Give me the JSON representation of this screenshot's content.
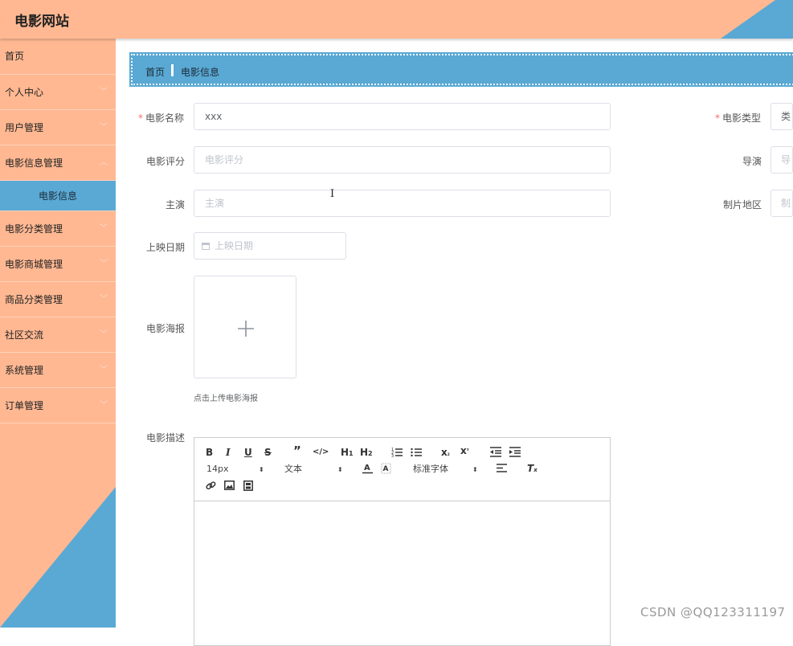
{
  "header": {
    "title": "电影网站"
  },
  "sidebar": {
    "items": [
      {
        "label": "首页",
        "chevron": false
      },
      {
        "label": "个人中心",
        "chevron": true
      },
      {
        "label": "用户管理",
        "chevron": true
      },
      {
        "label": "电影信息管理",
        "chevron": true
      },
      {
        "label": "电影分类管理",
        "chevron": true
      },
      {
        "label": "电影商城管理",
        "chevron": true
      },
      {
        "label": "商品分类管理",
        "chevron": true
      },
      {
        "label": "社区交流",
        "chevron": true
      },
      {
        "label": "系统管理",
        "chevron": true
      },
      {
        "label": "订单管理",
        "chevron": true
      }
    ],
    "sub_item": "电影信息"
  },
  "breadcrumb": {
    "home": "首页",
    "current": "电影信息"
  },
  "form": {
    "name_label": "电影名称",
    "name_value": "xxx",
    "type_label": "电影类型",
    "type_value": "类",
    "score_label": "电影评分",
    "score_placeholder": "电影评分",
    "director_label": "导演",
    "director_placeholder": "导",
    "actor_label": "主演",
    "actor_placeholder": "主演",
    "region_label": "制片地区",
    "region_placeholder": "制",
    "date_label": "上映日期",
    "date_placeholder": "上映日期",
    "poster_label": "电影海报",
    "poster_tip": "点击上传电影海报",
    "desc_label": "电影描述",
    "required_mark": "*"
  },
  "editor": {
    "font_size": "14px",
    "text_style": "文本",
    "font_family": "标准字体"
  },
  "watermark": "CSDN @QQ123311197",
  "colors": {
    "peach": "#ffb892",
    "blue": "#59a9d4"
  }
}
